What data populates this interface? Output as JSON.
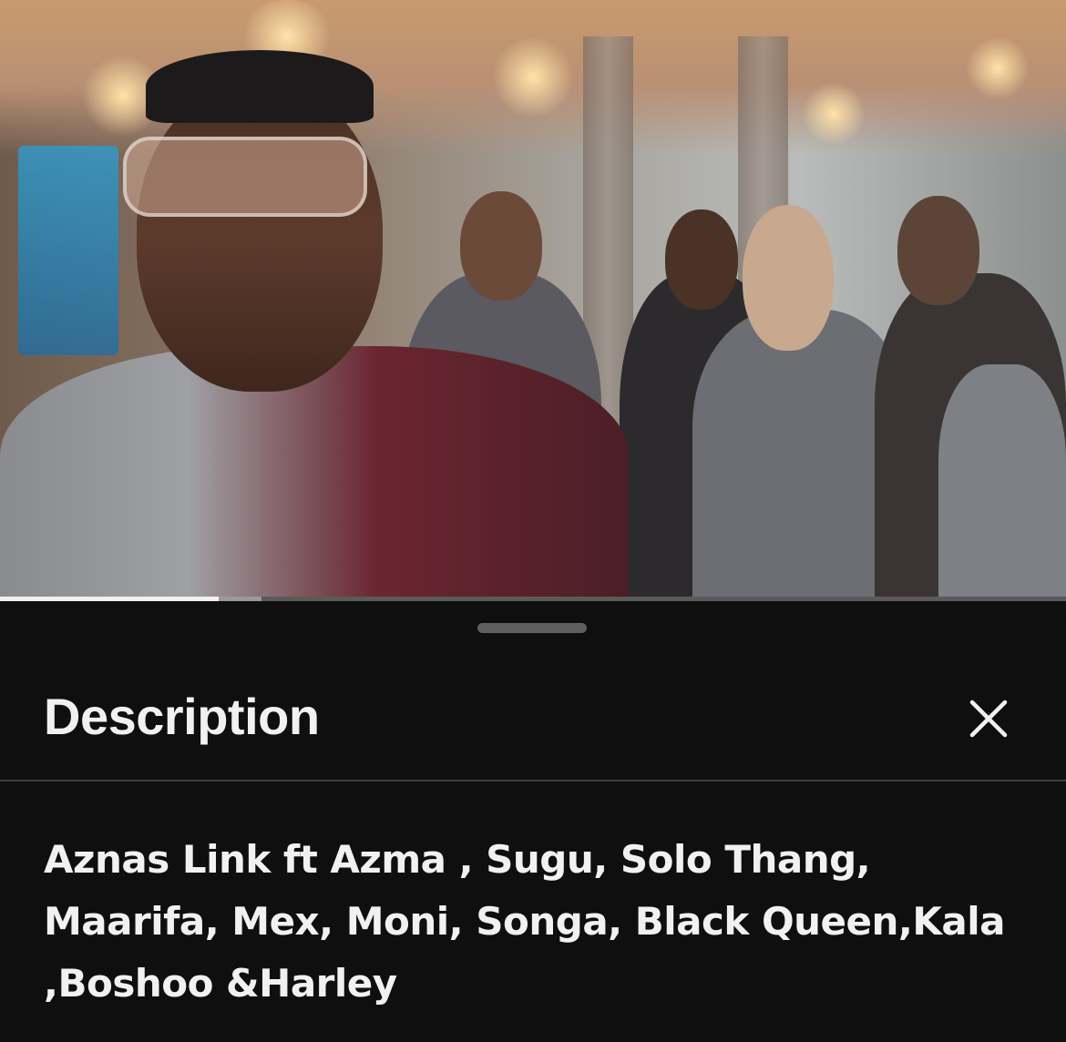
{
  "player": {
    "progress_played": 0.205,
    "progress_buffered": 0.245,
    "thumbnail_icon": "music-video-scene"
  },
  "sheet": {
    "title": "Description",
    "close_icon": "close-icon",
    "description": "Aznas Link ft Azma , Sugu, Solo Thang,\nMaarifa, Mex,  Moni, Songa, Black Queen,Kala\n,Boshoo &Harley"
  },
  "colors": {
    "background": "#0f0f0f",
    "text": "#f1f1f1",
    "divider": "#3d3d3d",
    "handle": "#5f5f5f"
  }
}
